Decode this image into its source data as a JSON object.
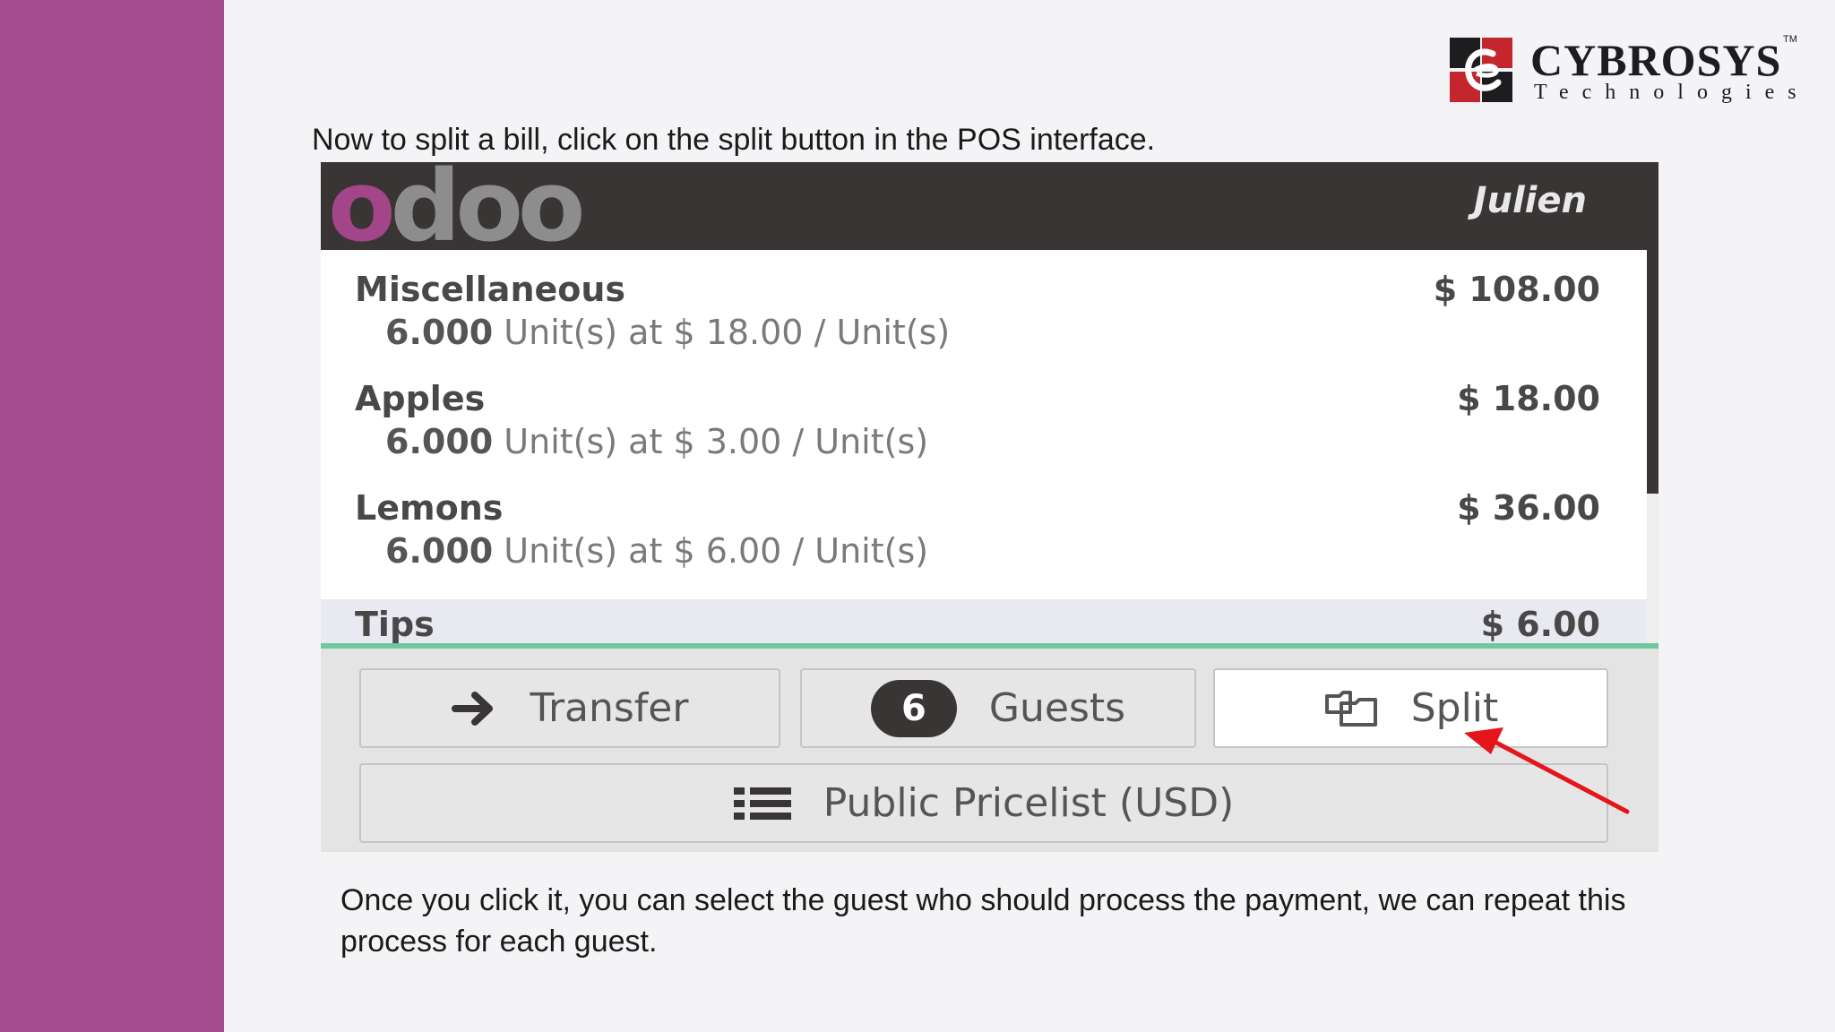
{
  "slide": {
    "caption_top": "Now to split a bill, click on the split button in the POS interface.",
    "caption_bottom": "Once you click it, you can select the guest who should process the payment, we can repeat this process for each guest.",
    "colors": {
      "sidebar": "#a54b8f",
      "logo_red": "#c4262e",
      "annotation_arrow": "#e5151b"
    }
  },
  "logo": {
    "name": "CYBROSYS",
    "trademark": "TM",
    "subtitle": "Technologies"
  },
  "pos": {
    "brand": "odoo",
    "user": "Julien",
    "order_lines": [
      {
        "product": "Miscellaneous",
        "quantity": "6.000",
        "detail": "Unit(s) at $ 18.00 / Unit(s)",
        "price": "$ 108.00"
      },
      {
        "product": "Apples",
        "quantity": "6.000",
        "detail": "Unit(s) at $ 3.00 / Unit(s)",
        "price": "$ 18.00"
      },
      {
        "product": "Lemons",
        "quantity": "6.000",
        "detail": "Unit(s) at $ 6.00 / Unit(s)",
        "price": "$ 36.00"
      }
    ],
    "tips": {
      "label": "Tips",
      "price": "$ 6.00"
    },
    "controls": {
      "transfer_label": "Transfer",
      "transfer_icon": "arrow-right-icon",
      "guests_count": "6",
      "guests_label": "Guests",
      "split_label": "Split",
      "split_icon": "copy-icon",
      "pricelist_label": "Public Pricelist (USD)",
      "pricelist_icon": "list-icon"
    },
    "colors": {
      "header": "#3a3535",
      "brand_purple": "#a24689",
      "tips_underline": "#6ec89b"
    }
  }
}
